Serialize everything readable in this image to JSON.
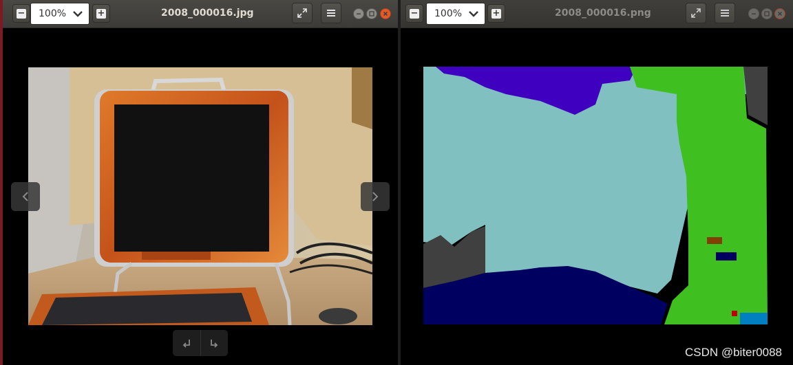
{
  "left_window": {
    "title": "2008_000016.jpg",
    "zoom": "100%"
  },
  "right_window": {
    "title": "2008_000016.png",
    "zoom": "100%"
  },
  "watermark": "CSDN @biter0088",
  "icons": {
    "zoom_out": "minus-icon",
    "zoom_in": "plus-icon",
    "fullscreen": "expand-icon",
    "menu": "hamburger-icon",
    "prev": "chevron-left-icon",
    "next": "chevron-right-icon",
    "rotate_left": "rotate-left-icon",
    "rotate_right": "rotate-right-icon"
  },
  "segmentation_colors": {
    "background": "#000000",
    "wall": "#80c0c0",
    "top_region": "#4000c0",
    "right_object": "#40c020",
    "table": "#000060",
    "left_gray": "#404040",
    "right_gray": "#404040",
    "accent_blue": "#0080c0",
    "accent_brown": "#804000",
    "accent_red": "#c00000"
  }
}
